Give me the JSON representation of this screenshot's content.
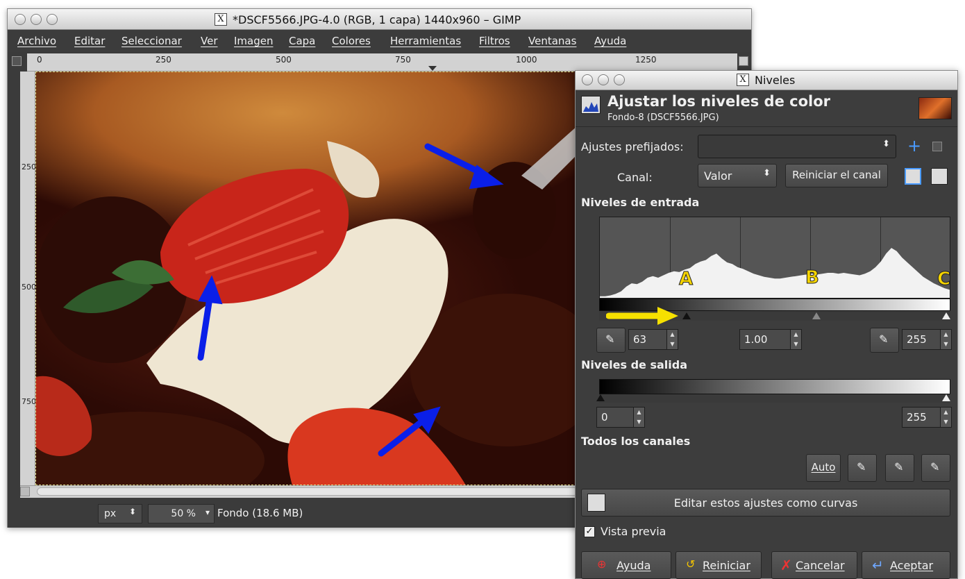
{
  "gimp": {
    "title": "*DSCF5566.JPG-4.0 (RGB, 1 capa) 1440x960 – GIMP",
    "menu": [
      "Archivo",
      "Editar",
      "Seleccionar",
      "Ver",
      "Imagen",
      "Capa",
      "Colores",
      "Herramientas",
      "Filtros",
      "Ventanas",
      "Ayuda"
    ],
    "ruler_top": [
      "0",
      "250",
      "500",
      "750",
      "1000",
      "1250"
    ],
    "ruler_left": [
      "250",
      "500",
      "750"
    ],
    "status": {
      "unit": "px",
      "zoom": "50 %",
      "layer_info": "Fondo (18.6 MB)"
    }
  },
  "levels": {
    "window_title": "Niveles",
    "header_title": "Ajustar los niveles de color",
    "header_subtitle": "Fondo-8 (DSCF5566.JPG)",
    "presets_label": "Ajustes prefijados:",
    "presets_value": "",
    "channel_label": "Canal:",
    "channel_value": "Valor",
    "reset_channel": "Reiniciar el canal",
    "input_levels": "Niveles de entrada",
    "marker_a": "A",
    "marker_b": "B",
    "marker_c": "C",
    "input_low": "63",
    "input_gamma": "1.00",
    "input_high": "255",
    "output_levels": "Niveles de salida",
    "output_low": "0",
    "output_high": "255",
    "all_channels": "Todos los canales",
    "auto": "Auto",
    "edit_curves": "Editar estos ajustes como curvas",
    "preview_label": "Vista previa",
    "preview_checked": true,
    "btn_help": "Ayuda",
    "btn_reset": "Reiniciar",
    "btn_cancel": "Cancelar",
    "btn_ok": "Aceptar"
  },
  "histogram_profile": [
    0.02,
    0.02,
    0.03,
    0.05,
    0.08,
    0.14,
    0.18,
    0.17,
    0.2,
    0.25,
    0.27,
    0.25,
    0.28,
    0.31,
    0.33,
    0.32,
    0.35,
    0.37,
    0.42,
    0.45,
    0.47,
    0.52,
    0.55,
    0.49,
    0.44,
    0.42,
    0.38,
    0.36,
    0.33,
    0.3,
    0.28,
    0.26,
    0.25,
    0.24,
    0.24,
    0.25,
    0.26,
    0.27,
    0.28,
    0.29,
    0.3,
    0.29,
    0.3,
    0.31,
    0.31,
    0.3,
    0.31,
    0.3,
    0.29,
    0.28,
    0.3,
    0.33,
    0.38,
    0.45,
    0.55,
    0.62,
    0.58,
    0.5,
    0.44,
    0.38,
    0.32,
    0.26,
    0.22,
    0.18,
    0.15,
    0.12,
    0.1
  ]
}
